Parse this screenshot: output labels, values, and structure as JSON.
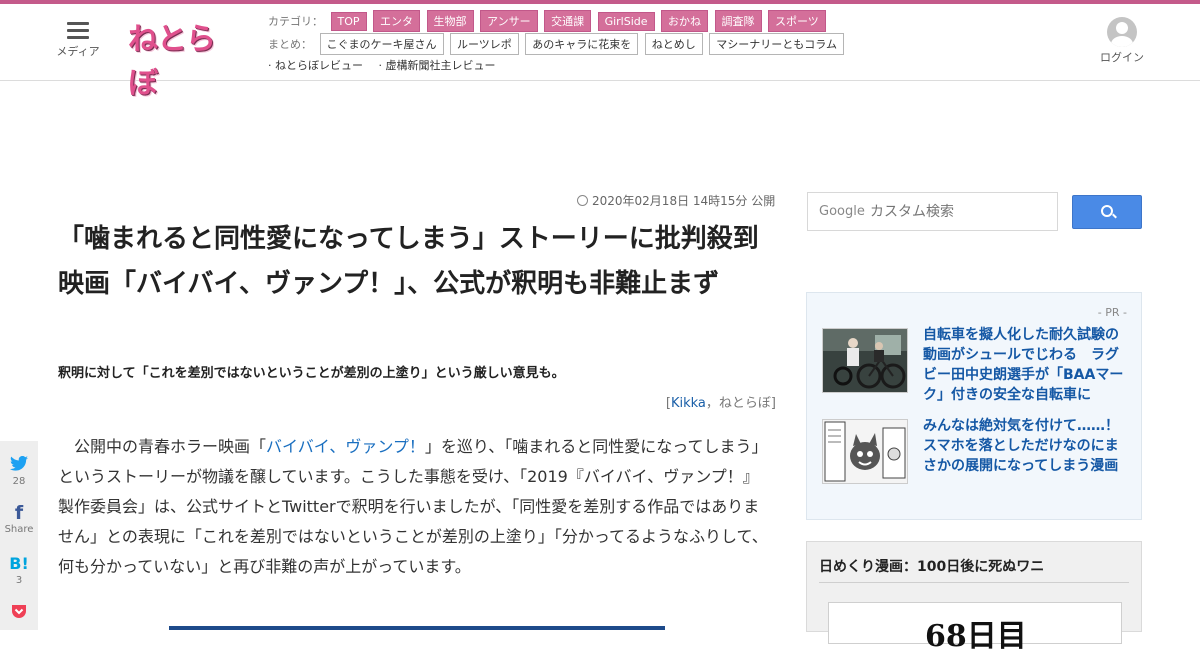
{
  "header": {
    "menu_label": "メディア",
    "logo_text": "ねとらぼ",
    "category_label": "カテゴリ：",
    "categories": [
      "TOP",
      "エンタ",
      "生物部",
      "アンサー",
      "交通課",
      "GirlSide",
      "おかね",
      "調査隊",
      "スポーツ"
    ],
    "matome_label": "まとめ：",
    "matome": [
      "こぐまのケーキ屋さん",
      "ルーツレポ",
      "あのキャラに花束を",
      "ねとめし",
      "マシーナリーともコラム"
    ],
    "reviews": [
      "· ねとらぼレビュー",
      "· 虚構新聞社主レビュー"
    ],
    "login_label": "ログイン"
  },
  "article": {
    "date": "2020年02月18日 14時15分 公開",
    "title": "「噛まれると同性愛になってしまう」ストーリーに批判殺到　映画「バイバイ、ヴァンプ！」、公式が釈明も非難止まず",
    "lead": "釈明に対して「これを差別ではないということが差別の上塗り」という厳しい意見も。",
    "byline_open": "[",
    "byline_author": "Kikka",
    "byline_sep": "，",
    "byline_site": "ねとらぼ",
    "byline_close": "]",
    "body_pre": "公開中の青春ホラー映画「",
    "body_link": "バイバイ、ヴァンプ！",
    "body_post": "」を巡り、「噛まれると同性愛になってしまう」というストーリーが物議を醸しています。こうした事態を受け、「2019『バイバイ、ヴァンプ！』製作委員会」は、公式サイトとTwitterで釈明を行いましたが、「同性愛を差別する作品ではありません」との表現に「これを差別ではないということが差別の上塗り」「分かってるようなふりして、何も分かっていない」と再び非難の声が上がっています。"
  },
  "share": {
    "twitter_count": "28",
    "facebook_label": "Share",
    "hatena_count": "3"
  },
  "sidebar": {
    "search_brand": "Google",
    "search_placeholder": "カスタム検索",
    "pr_label": "- PR -",
    "pr_items": [
      "自転車を擬人化した耐久試験の動画がシュールでじわる　ラグビー田中史朗選手が「BAAマーク」付きの安全な自転車に",
      "みんなは絶対気を付けて……！　スマホを落としただけなのにまさかの展開になってしまう漫画"
    ],
    "manga_title": "日めくり漫画：100日後に死ぬワニ",
    "manga_day": "68日目"
  },
  "colors": {
    "brand_pink": "#d46f9a",
    "link_blue": "#1a6fc0",
    "twitter": "#1da1f2",
    "facebook": "#3b5998",
    "hatena": "#00a4de",
    "pocket": "#ef4056"
  }
}
